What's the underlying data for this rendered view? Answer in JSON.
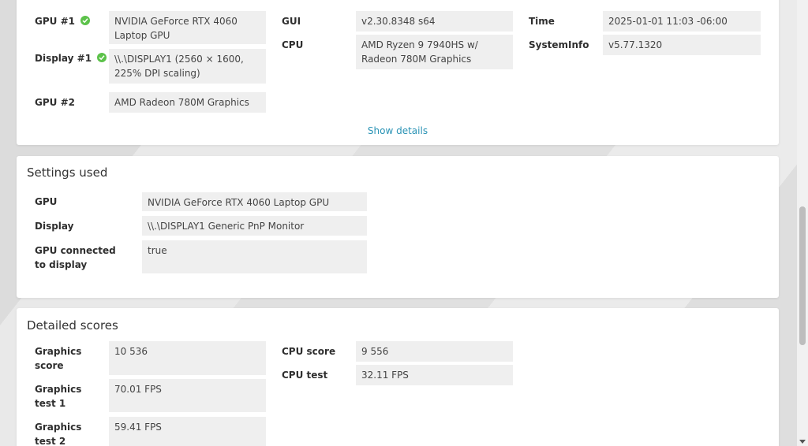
{
  "system": {
    "gpu1": {
      "label": "GPU #1",
      "value": "NVIDIA GeForce RTX 4060 Laptop GPU"
    },
    "display1": {
      "label": "Display #1",
      "value": "\\\\.\\DISPLAY1 (2560 × 1600, 225% DPI scaling)"
    },
    "gpu2": {
      "label": "GPU #2",
      "value": "AMD Radeon 780M Graphics"
    },
    "gui": {
      "label": "GUI",
      "value": "v2.30.8348 s64"
    },
    "cpu": {
      "label": "CPU",
      "value": "AMD Ryzen 9 7940HS w/ Radeon 780M Graphics"
    },
    "time": {
      "label": "Time",
      "value": "2025-01-01 11:03 -06:00"
    },
    "systeminfo": {
      "label": "SystemInfo",
      "value": "v5.77.1320"
    },
    "show_details": "Show details"
  },
  "settings": {
    "title": "Settings used",
    "gpu": {
      "label": "GPU",
      "value": "NVIDIA GeForce RTX 4060 Laptop GPU"
    },
    "display": {
      "label": "Display",
      "value": "\\\\.\\DISPLAY1 Generic PnP Monitor"
    },
    "gpu_connected": {
      "label": "GPU connected to display",
      "value": "true"
    }
  },
  "scores": {
    "title": "Detailed scores",
    "graphics_score": {
      "label": "Graphics score",
      "value": "10 536"
    },
    "graphics_test1": {
      "label": "Graphics test 1",
      "value": "70.01 FPS"
    },
    "graphics_test2": {
      "label": "Graphics test 2",
      "value": "59.41 FPS"
    },
    "cpu_score": {
      "label": "CPU score",
      "value": "9 556"
    },
    "cpu_test": {
      "label": "CPU test",
      "value": "32.11 FPS"
    }
  },
  "colors": {
    "accent_link": "#2a93b5",
    "check_green": "#5cc24a",
    "value_bg": "#efefef"
  },
  "icons": {
    "status": "check-circle-icon"
  }
}
